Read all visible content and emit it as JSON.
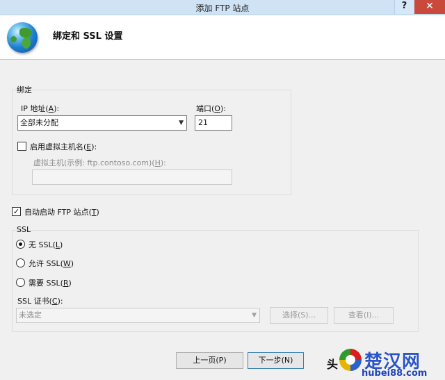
{
  "window": {
    "title": "添加 FTP 站点",
    "help_glyph": "?",
    "close_glyph": "✕"
  },
  "header": {
    "title": "绑定和 SSL 设置",
    "icon": "globe-icon"
  },
  "binding": {
    "group_label": "绑定",
    "ip_label": "IP 地址(",
    "ip_key": "A",
    "ip_label_end": "):",
    "ip_value": "全部未分配",
    "port_label": "端口(",
    "port_key": "O",
    "port_label_end": "):",
    "port_value": "21",
    "virtual_host_checkbox_label": "启用虚拟主机名(",
    "virtual_host_key": "E",
    "virtual_host_checkbox_end": "):",
    "virtual_host_checked": false,
    "virtual_host_field_label": "虚拟主机(示例: ftp.contoso.com)(",
    "virtual_host_field_key": "H",
    "virtual_host_field_end": "):",
    "virtual_host_value": ""
  },
  "autostart": {
    "label": "自动启动 FTP 站点(",
    "key": "T",
    "label_end": ")",
    "checked": true,
    "check_glyph": "✓"
  },
  "ssl": {
    "group_label": "SSL",
    "options": [
      {
        "label": "无 SSL(",
        "key": "L",
        "end": ")",
        "selected": true
      },
      {
        "label": "允许 SSL(",
        "key": "W",
        "end": ")",
        "selected": false
      },
      {
        "label": "需要 SSL(",
        "key": "R",
        "end": ")",
        "selected": false
      }
    ],
    "cert_label": "SSL 证书(",
    "cert_key": "C",
    "cert_end": "):",
    "cert_value": "未选定",
    "select_button": "选择(S)...",
    "view_button": "查看(I)..."
  },
  "footer": {
    "prev_button": "上一页(P)",
    "next_button": "下一步(N)",
    "finish_button_visible": "头"
  },
  "watermark": {
    "text_left": "头",
    "brand": "楚汉网",
    "url": "hubei88.com"
  },
  "colors": {
    "titlebar": "#cfe3f5",
    "close_button": "#c94a3c",
    "watermark_brand": "#2a54c8"
  }
}
